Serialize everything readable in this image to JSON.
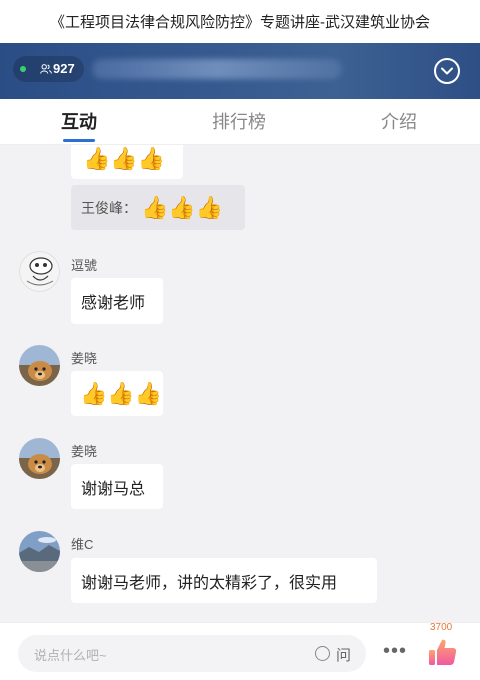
{
  "window": {
    "title": "《工程项目法律合规风险防控》专题讲座-武汉建筑业协会"
  },
  "banner": {
    "viewer_count": "927",
    "live_status_color": "#36d36b",
    "background_color": "#35598f",
    "icons": [
      "people-icon",
      "collapse-chevron-icon"
    ]
  },
  "tabs": [
    {
      "label": "互动",
      "active": true
    },
    {
      "label": "排行榜",
      "active": false
    },
    {
      "label": "介绍",
      "active": false
    }
  ],
  "chat": {
    "thumb_emoji": "👍",
    "messages": [
      {
        "partial": true,
        "text": "👍👍👍"
      },
      {
        "sender_prefix": "王俊峰：",
        "text": "👍👍👍",
        "style": "grey"
      },
      {
        "name": "逗號",
        "text": "感谢老师",
        "avatar": "sketch-avatar"
      },
      {
        "name": "姜晓",
        "text": "👍👍👍",
        "avatar": "dog-avatar"
      },
      {
        "name": "姜晓",
        "text": "谢谢马总",
        "avatar": "dog-avatar"
      },
      {
        "name": "维C",
        "text": "谢谢马老师，讲的太精彩了，很实用",
        "avatar": "landscape-avatar"
      }
    ]
  },
  "bottom": {
    "input_placeholder": "说点什么吧~",
    "ask_label": "问",
    "more_label": "•••",
    "like_count": "3700",
    "like_color": "#f06aa0"
  }
}
